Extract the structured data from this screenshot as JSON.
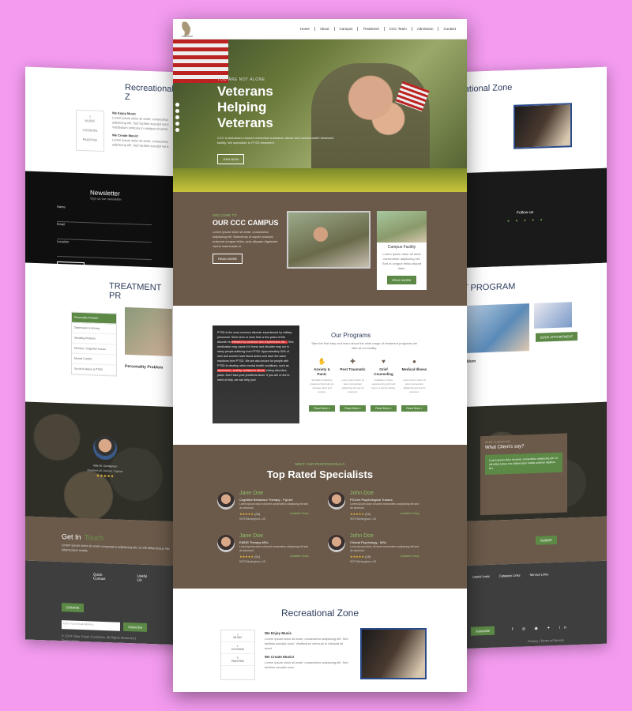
{
  "nav": {
    "items": [
      "Home",
      "About",
      "Campus",
      "Treatment",
      "CCC Team",
      "Admission",
      "Contact"
    ]
  },
  "hero": {
    "kicker": "YOU ARE NOT ALONE",
    "title_line1": "Veterans",
    "title_line2": "Helping",
    "title_line3": "Veterans",
    "description": "CCC is Alabama's newest residential substance abuse and mental health treatment facility. We specialize in PTSD treatment.",
    "button": "JOIN NOW"
  },
  "campus": {
    "kicker": "WELCOME TO",
    "title": "OUR CCC CAMPUS",
    "text": "Lorem ipsum dolor sit amet, consectetur adipiscing elit. Maecenas ut sapien suscipit, euismod congue tellus, quis aliquam dignissim, varius malesuada ut.",
    "button": "READ MORE",
    "card_title": "Campus Facility",
    "card_text": "Lorem ipsum dolor sit amet consectetur adipiscing elit. Sed ut congue tellus aliquet diam.",
    "card_button": "READ MORE"
  },
  "ptsd": {
    "text_a": "PTSD is the most common disorder experienced by military personnel. Short-term or more than a few years of this disorder is ",
    "hl_a": "reflected by someone who experiences the...",
    "text_b": " Self-medication may cause it in these and disorder may run in many people suffering from PTSD. Approximately 30% of men and women have faced action and have the same reactions from PTSD. We are also known for people with PTSD to develop other mental health conditions, such as ",
    "hl_b": "depression, anxiety, substance abuse,",
    "text_c": " eating disorders, panic. Don't face your problems alone. If you are or are in need of help, we can help you!"
  },
  "programs": {
    "title": "Our Programs",
    "subtitle": "Take the first step and learn about the wide range of treatment programs we offer at our facility.",
    "items": [
      {
        "name": "Anxiety & Panic",
        "icon": "hands-icon",
        "desc": "Sensible & effective programs that help you manage panic and anxiety.",
        "button": "Read More »"
      },
      {
        "name": "Post Traumatic",
        "icon": "puzzle-icon",
        "desc": "Lorem ipsum dolor sit amet consectetur adipiscing elit sed do eiusmod.",
        "button": "Read More »"
      },
      {
        "name": "Grief Counseling",
        "icon": "heart-icon",
        "desc": "Available to those experiencing grief and loss in a caring setting.",
        "button": "Read More »"
      },
      {
        "name": "Medical Illness",
        "icon": "user-icon",
        "desc": "Lorem ipsum dolor sit amet consectetur adipiscing elit sed do eiusmod.",
        "button": "Read More »"
      }
    ]
  },
  "specialists": {
    "kicker": "MEET OUR PROFESSIONALS",
    "title": "Top Rated Specialists",
    "doctors": [
      {
        "name": "Jane Doe",
        "role": "Cognitive Behaviour Therapy - PgCert",
        "desc": "Lorem ipsum dolor sit amet consectetur adipiscing elit sed do eiusmod.",
        "stars": "★★★★★",
        "reviews": "(25)",
        "availability": "Available Today",
        "location": "9079 Birmingham, US"
      },
      {
        "name": "John Doe",
        "role": "PGCert Psychological Trauma",
        "desc": "Lorem ipsum dolor sit amet consectetur adipiscing elit sed do eiusmod.",
        "stars": "★★★★★",
        "reviews": "(22)",
        "availability": "Available Today",
        "location": "9079 Birmingham, US"
      },
      {
        "name": "Jane Doe",
        "role": "EMDR Therapy MSc",
        "desc": "Lorem ipsum dolor sit amet consectetur adipiscing elit sed do eiusmod.",
        "stars": "★★★★★",
        "reviews": "(51)",
        "availability": "Available Today",
        "location": "9079 Birmingham, US"
      },
      {
        "name": "John Doe",
        "role": "Clinical Psychology - MSc",
        "desc": "Lorem ipsum dolor sit amet consectetur adipiscing elit sed do eiusmod.",
        "stars": "★★★★★",
        "reviews": "(15)",
        "availability": "Available Today",
        "location": "9079 Birmingham, US"
      }
    ]
  },
  "recreational": {
    "title": "Recreational Zone",
    "tabs": [
      "MUSIC",
      "COOKING",
      "PAINTING"
    ],
    "h1": "We Enjoy Music",
    "p1": "Lorem ipsum dolor sit amet, consectetur adipiscing elit. Sed facilisis suscipit nunc. Vestibulum vehicula in volutpat sit amet.",
    "h2": "We Create Music!",
    "p2": "Lorem ipsum dolor sit amet, consectetur adipiscing elit. Sed facilisis suscipit nunc."
  },
  "left": {
    "rec_title": "Recreational Z",
    "news_title": "Newsletter",
    "news_sub": "Sign up our newsletter",
    "fields": [
      "Name",
      "Email",
      "Location"
    ],
    "subscribe": "SUBSCRIBE",
    "treat_title": "TREATMENT PR",
    "list": [
      "Personality Problem",
      "Depression & Anxiety",
      "Smoking Problem",
      "Memory / Cognitive Issues",
      "Mental Conflict",
      "Social Isolation & PTSD"
    ],
    "problem_title": "Personality Problem",
    "client_name": "Alfie W. Gentlemen",
    "client_role": "Disabled US Veteran, Captain",
    "client_stars": "★★★★★",
    "touch": "Get In",
    "touch_accent": "Touch",
    "touch_sub": "Lorem ipsum dolor sit amet consectetur adipiscing elit. Ut elit tellus luctus nec ullamcorper mattis.",
    "foot_col1": "Quick Contact",
    "foot_col2": "Useful Lin",
    "donate": "DONATE",
    "email_ph": "Enter Your Email Address",
    "subscribe2": "Subscribe",
    "copyright": "© 2024 Clear Creek Commons. All Rights Reserved | Designed by"
  },
  "right": {
    "rec_title": "reational Zone",
    "follow": "Follow us",
    "treat_title": "NT PROGRAM",
    "button": "BOOK APPOINTMENT",
    "problem": "y Problem",
    "say_kicker": "WHAT CLIENTS SAY",
    "say_title": "What Client's say?",
    "say_text": "Lorem ipsum dolor sit amet, consectetur adipiscing elit. Ut elit tellus luctus nec ullamcorper mattis pulvinar dapibus leo.",
    "contact_btn": "SUBMIT",
    "useful": "Useful Links",
    "category": "Category Links",
    "service": "Service Links",
    "policy": "Privacy | Terms of Service",
    "subscribe": "Subscribe"
  },
  "colors": {
    "brown": "#6b5a4a",
    "green": "#5c8a46",
    "navy": "#2a3a5a",
    "pink_bg": "#f49bf0"
  }
}
